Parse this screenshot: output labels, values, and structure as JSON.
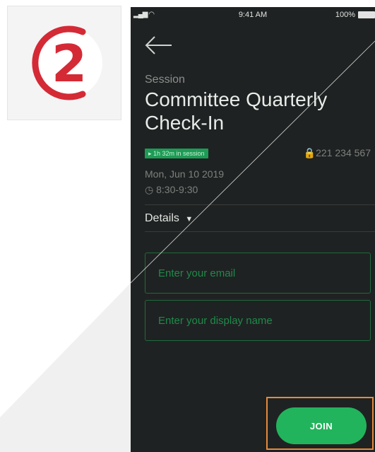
{
  "step": {
    "number": "2",
    "accent_color": "#d42a36"
  },
  "status_bar": {
    "time": "9:41 AM",
    "battery": "100%"
  },
  "session": {
    "eyebrow": "Session",
    "title": "Committee Quarterly Check-In",
    "in_session_badge": "▸ 1h 32m in session",
    "meeting_id": "🔒221 234 567",
    "date": "Mon, Jun 10 2019",
    "time_range": "◷ 8:30-9:30"
  },
  "details": {
    "label": "Details",
    "icon": "caret-down-icon"
  },
  "form": {
    "email_placeholder": "Enter your email",
    "display_name_placeholder": "Enter your display name",
    "join_label": "JOIN"
  },
  "colors": {
    "background": "#1f2222",
    "primary_green": "#22b45c",
    "badge_green": "#1d9c55",
    "highlight_orange": "#e58a3c"
  }
}
